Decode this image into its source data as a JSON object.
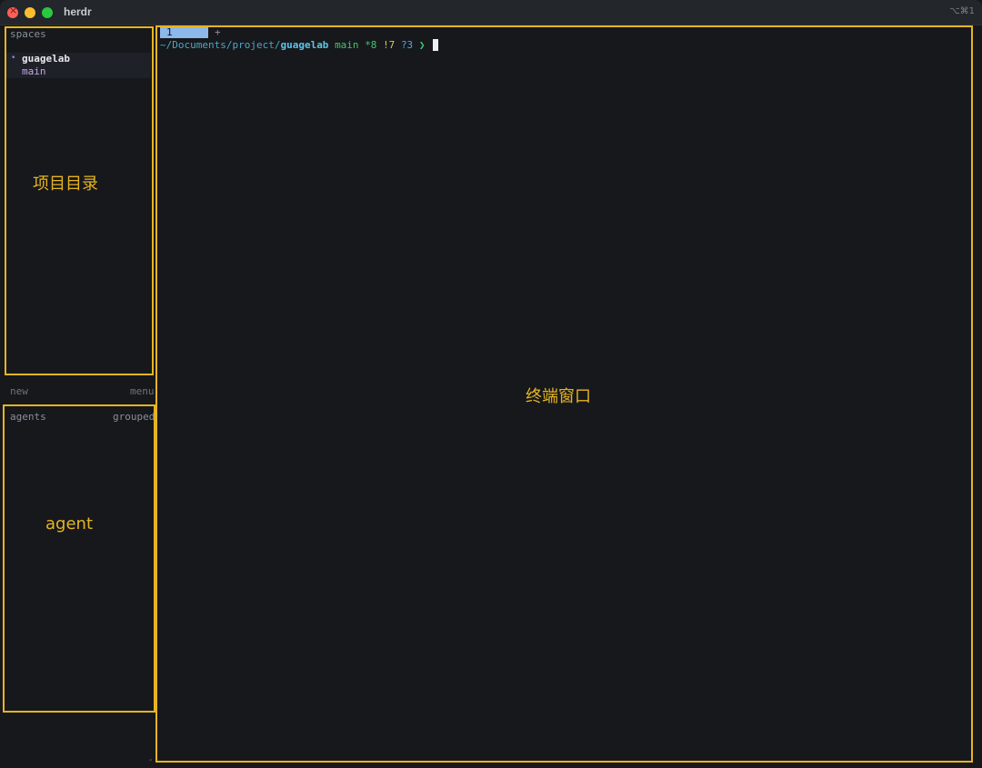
{
  "window": {
    "title": "herdr",
    "shortcut": "⌥⌘1"
  },
  "sidebar": {
    "spaces_label": "spaces",
    "spaces": [
      {
        "name": "guagelab",
        "branch": "main"
      }
    ],
    "new_label": "new",
    "menu_label": "menu",
    "agents_label": "agents",
    "grouped_label": "grouped"
  },
  "terminal": {
    "tab_label": "1",
    "add_tab": "+",
    "prompt": {
      "path": "~/Documents/project/",
      "repo": "guagelab",
      "branch": "main",
      "modified": "*8",
      "untracked_changes": "!7",
      "unknown": "?3",
      "arrow": "❯"
    }
  },
  "annotations": {
    "project_dir": "项目目录",
    "agent": "agent",
    "terminal_window": "终端窗口"
  },
  "colors": {
    "highlight": "#e6b422",
    "background": "#16181c",
    "tab_active": "#8cb8ea"
  }
}
